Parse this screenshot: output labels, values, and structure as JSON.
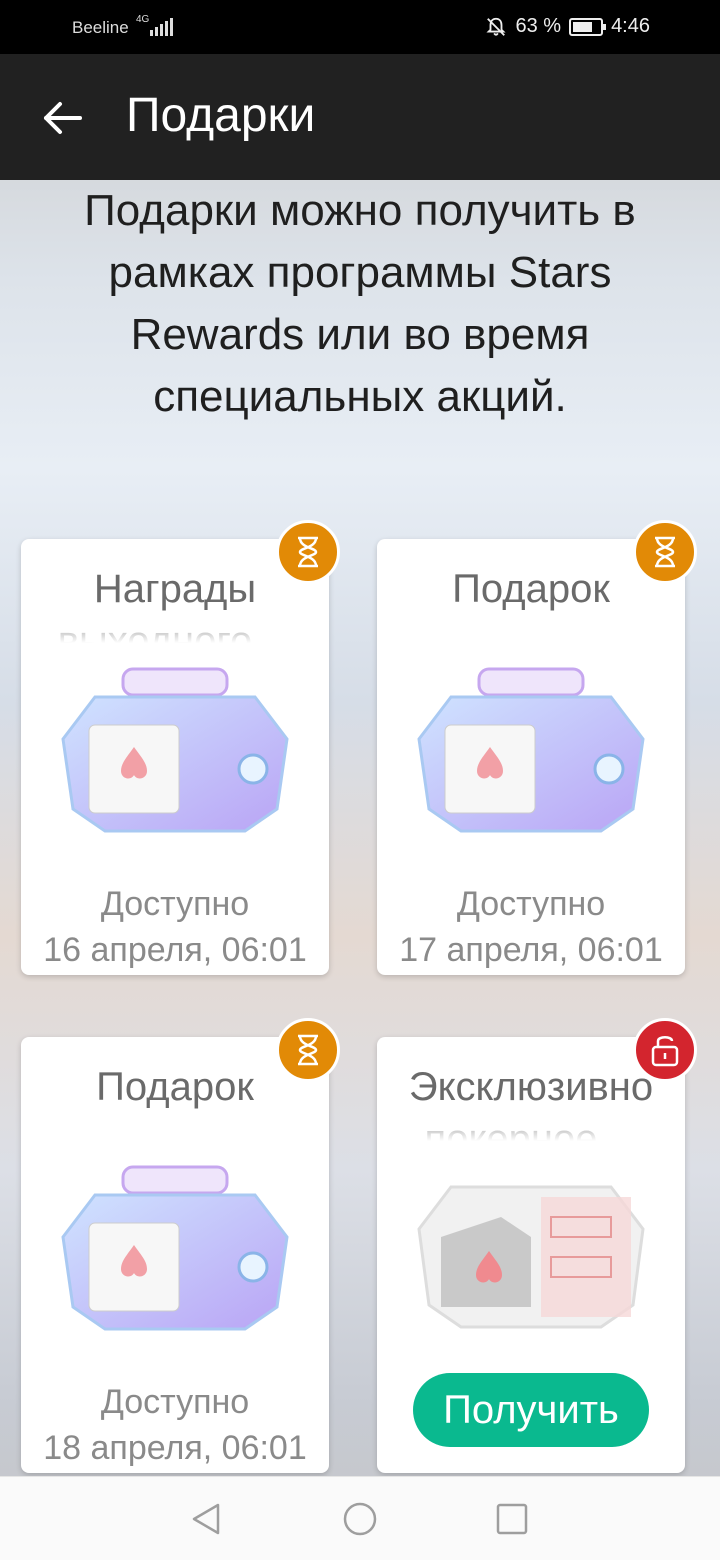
{
  "status_bar": {
    "carrier": "Beeline",
    "network": "4G",
    "battery": "63 %",
    "battery_level": 0.63,
    "time": "4:46"
  },
  "app_bar": {
    "title": "Подарки",
    "back_icon": "arrow-left-icon"
  },
  "intro_text": "Подарки можно получить в рамках программы Stars Rewards или во время специальных акций.",
  "cards": [
    {
      "title": "Награды выходного…",
      "badge": "hourglass-icon",
      "status_label": "Доступно",
      "date": "16 апреля, 06:01"
    },
    {
      "title": "Подарок",
      "badge": "hourglass-icon",
      "status_label": "Доступно",
      "date": "17 апреля, 06:01"
    },
    {
      "title": "Подарок",
      "badge": "hourglass-icon",
      "status_label": "Доступно",
      "date": "18 апреля, 06:01"
    },
    {
      "title": "Эксклюзивно покерное…",
      "badge": "unlock-icon",
      "button_label": "Получить"
    }
  ],
  "colors": {
    "accent_green": "#0ab98f",
    "timer_badge": "#e28a06",
    "lock_badge": "#d3252e",
    "app_bar": "#212121"
  }
}
